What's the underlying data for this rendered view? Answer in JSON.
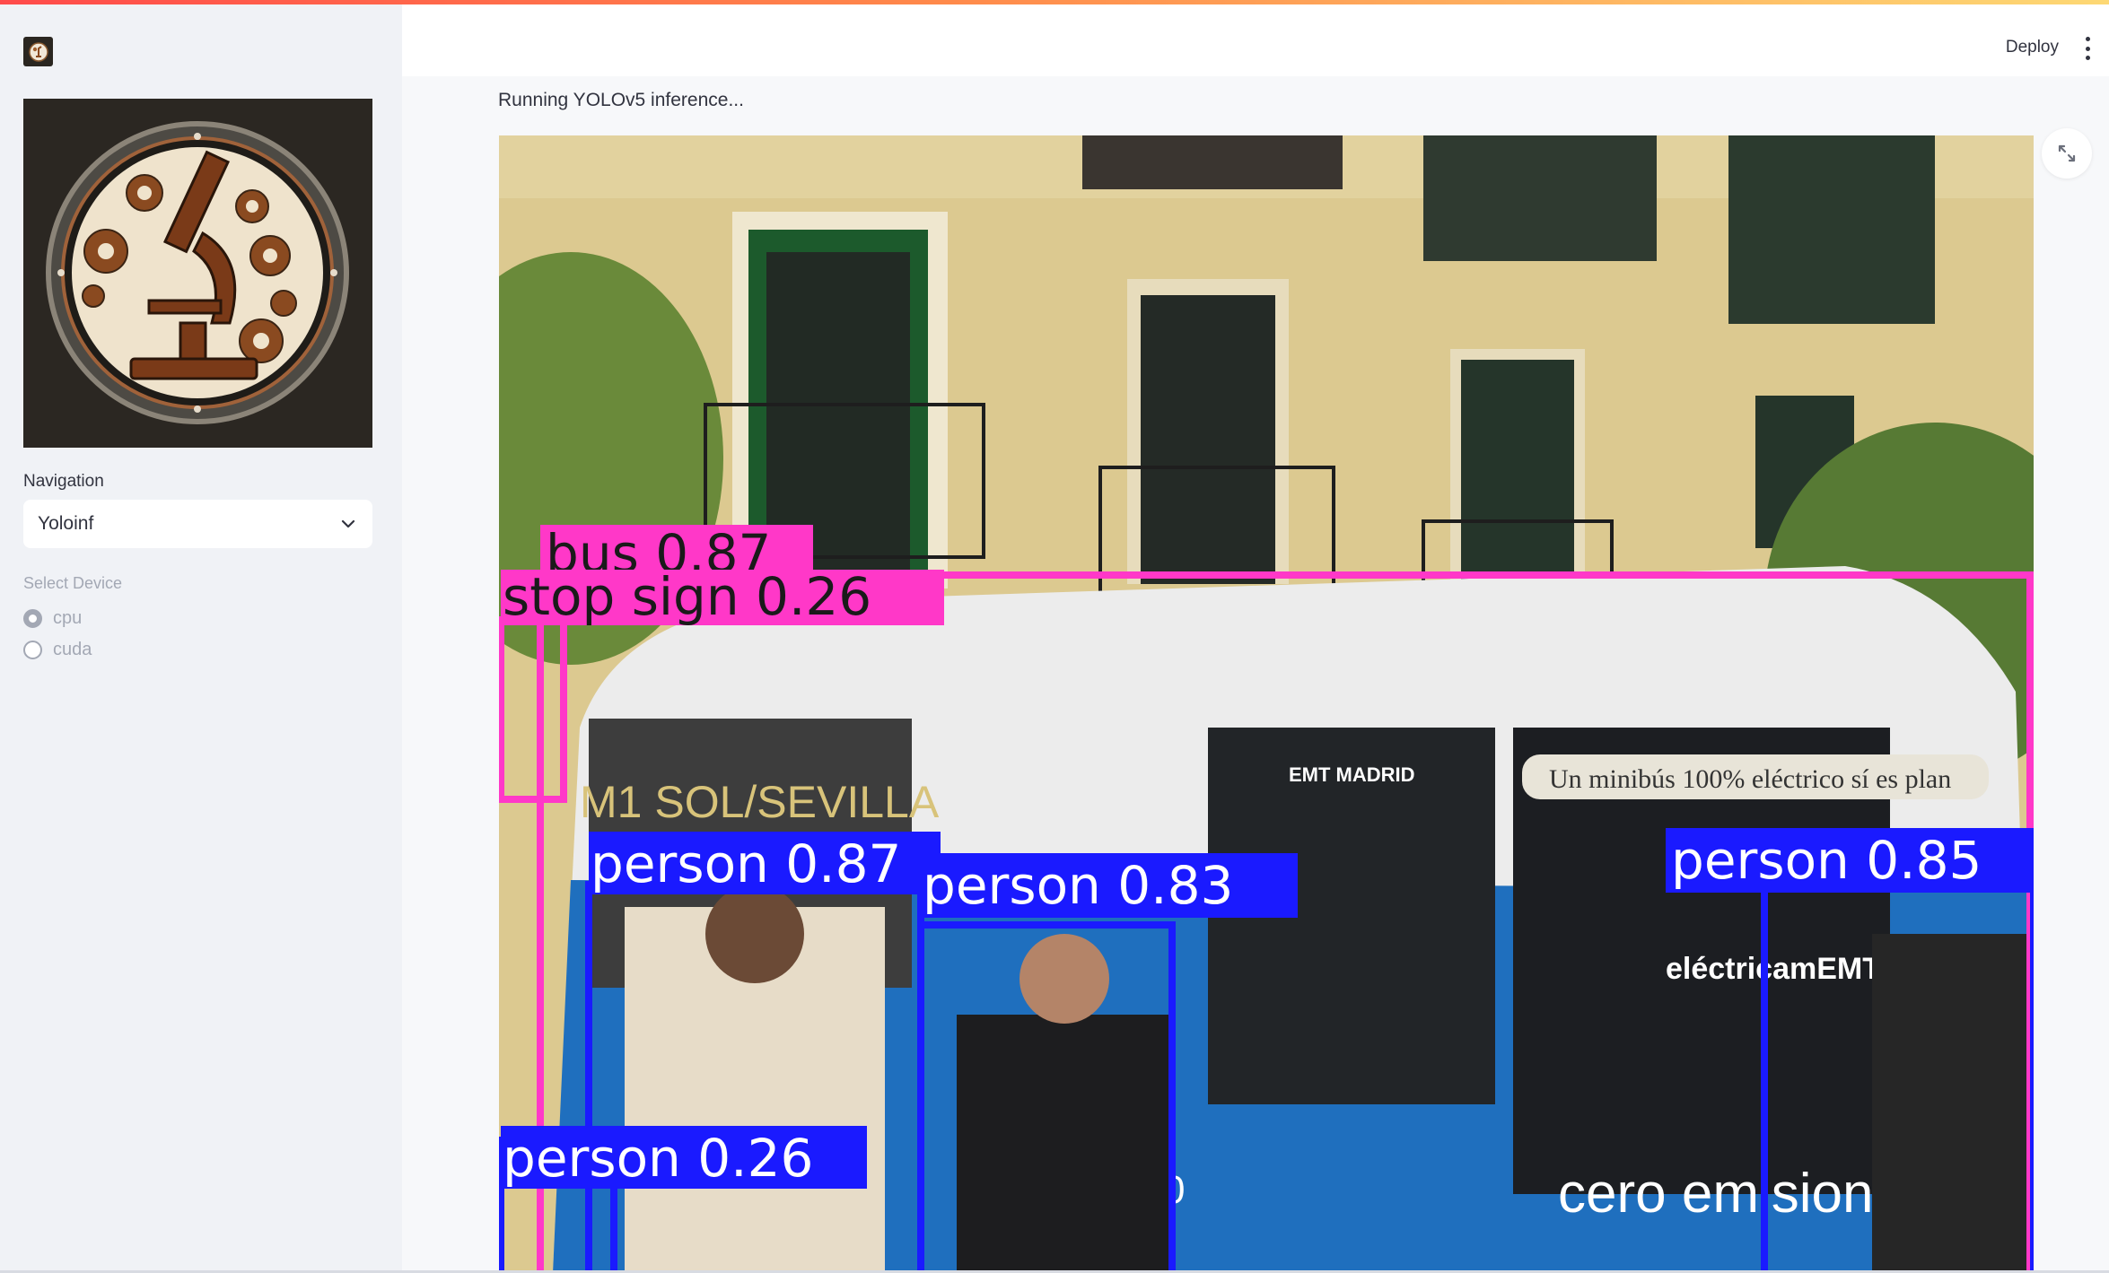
{
  "app": {
    "accent_stripe": [
      "#ff4b4b",
      "#fdd874"
    ]
  },
  "header": {
    "deploy_label": "Deploy",
    "menu_icon": "vertical-dots-icon"
  },
  "sidebar": {
    "logo_icon": "microscope-gears-icon",
    "navigation": {
      "label": "Navigation",
      "selected": "Yoloinf"
    },
    "device": {
      "label": "Select Device",
      "options": [
        {
          "label": "cpu",
          "checked": true
        },
        {
          "label": "cuda",
          "checked": false
        }
      ]
    }
  },
  "main": {
    "status": "Running YOLOv5 inference...",
    "fullscreen_icon": "expand-icon",
    "detections": [
      {
        "label": "bus 0.87",
        "color": "#ff38c8"
      },
      {
        "label": "stop sign 0.26",
        "color": "#ff38c8"
      },
      {
        "label": "person 0.87",
        "color": "#1a1aff"
      },
      {
        "label": "person 0.83",
        "color": "#1a1aff"
      },
      {
        "label": "person 0.85",
        "color": "#1a1aff"
      },
      {
        "label": "person 0.26",
        "color": "#1a1aff"
      }
    ],
    "bus_text": {
      "route": "M1 SOL/SEVILLA",
      "emt": "EMT MADRID",
      "banner": "Un minibús 100% eléctrico sí es plan",
      "brand": "eléctricamEMTe",
      "slogan": "cero emisiones",
      "number": "0"
    }
  }
}
